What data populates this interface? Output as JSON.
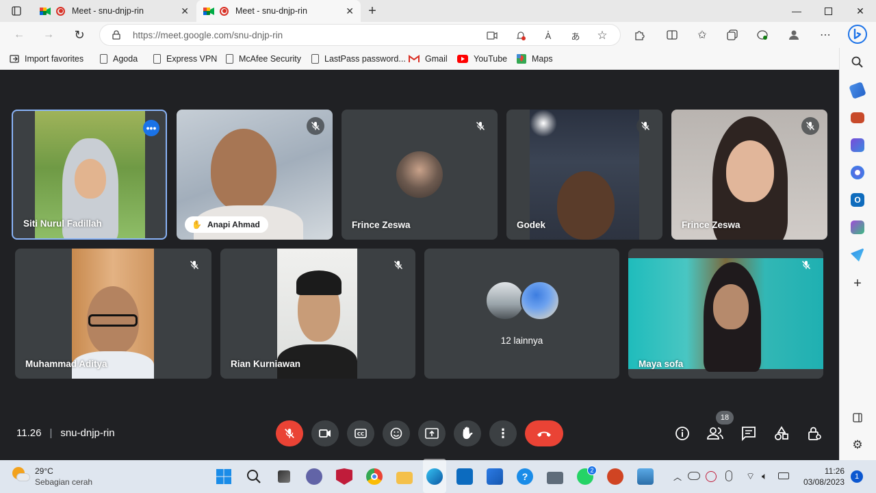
{
  "browser": {
    "tabs": [
      {
        "title": "Meet - snu-dnjp-rin",
        "active": false
      },
      {
        "title": "Meet - snu-dnjp-rin",
        "active": true
      }
    ],
    "url_domain": "https://meet.google.com",
    "url_path": "/snu-dnjp-rin",
    "favorites": [
      {
        "label": "Import favorites",
        "icon": "import-icon"
      },
      {
        "label": "Agoda",
        "icon": "page-icon"
      },
      {
        "label": "Express VPN",
        "icon": "page-icon"
      },
      {
        "label": "McAfee Security",
        "icon": "page-icon"
      },
      {
        "label": "LastPass password...",
        "icon": "page-icon"
      },
      {
        "label": "Gmail",
        "icon": "gmail-icon"
      },
      {
        "label": "YouTube",
        "icon": "youtube-icon"
      },
      {
        "label": "Maps",
        "icon": "maps-icon"
      }
    ]
  },
  "meet": {
    "participants": [
      {
        "name": "Siti Nurul Fadillah",
        "pinned": true
      },
      {
        "name": "Anapi Ahmad",
        "hand_raised": true
      },
      {
        "name": "Frince Zeswa"
      },
      {
        "name": "Godek"
      },
      {
        "name": "Frince Zeswa"
      },
      {
        "name": "Muhammad Aditya"
      },
      {
        "name": "Rian Kurniawan"
      },
      {
        "name": "12 lainnya"
      },
      {
        "name": "Maya sofa"
      }
    ],
    "time": "11.26",
    "meeting_code": "snu-dnjp-rin",
    "people_count": "18",
    "colors": {
      "bg": "#202124",
      "tile": "#3c4043",
      "red": "#ea4335",
      "accent": "#8ab4f8"
    }
  },
  "taskbar": {
    "temperature": "29°C",
    "weather": "Sebagian cerah",
    "time": "11:26",
    "date": "03/08/2023",
    "notifications": "1",
    "whatsapp_badge": "2"
  }
}
